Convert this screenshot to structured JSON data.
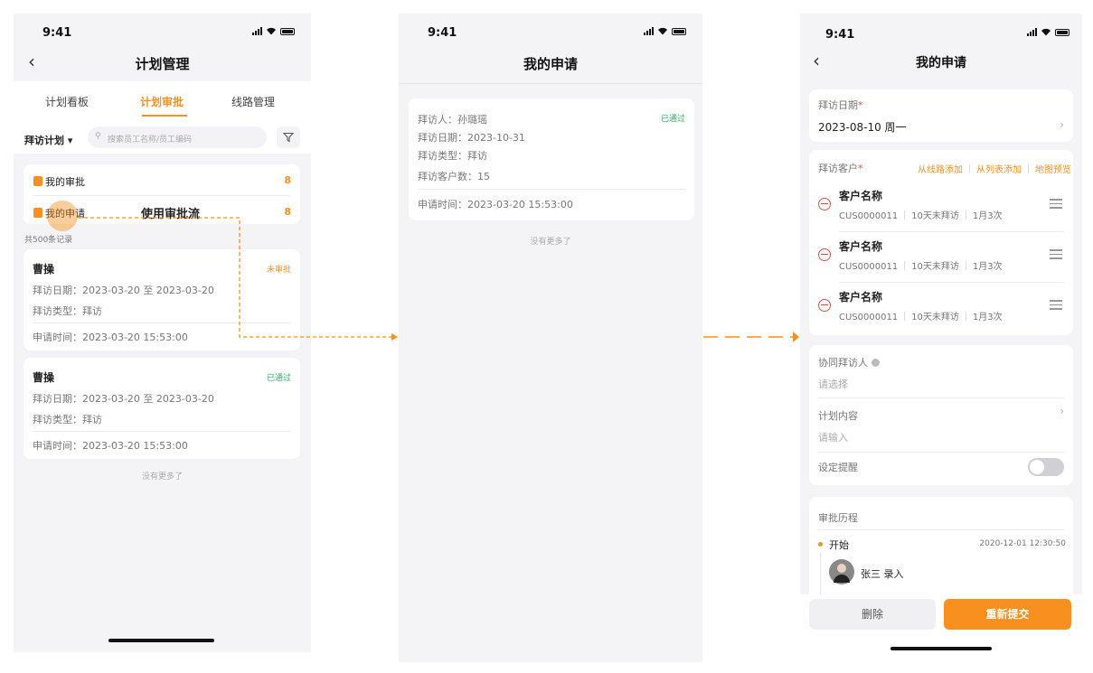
{
  "status": {
    "time": "9:41"
  },
  "screen1": {
    "title": "计划管理",
    "tabs": [
      "计划看板",
      "计划审批",
      "线路管理"
    ],
    "filter_dropdown": "拜访计划 ▾",
    "search_placeholder": "搜索员工名称/员工编码",
    "summary": [
      {
        "label": "我的审批",
        "count": "8"
      },
      {
        "label": "我的申请",
        "count": "8"
      }
    ],
    "annotation": "使用审批流",
    "record_count": "共500条记录",
    "records": [
      {
        "name": "曹操",
        "status": "未审批",
        "date": "拜访日期：2023-03-20 至 2023-03-20",
        "type": "拜访类型：拜访",
        "apply_time": "申请时间：2023-03-20 15:53:00"
      },
      {
        "name": "曹操",
        "status": "已通过",
        "date": "拜访日期：2023-03-20 至 2023-03-20",
        "type": "拜访类型：拜访",
        "apply_time": "申请时间：2023-03-20 15:53:00"
      }
    ],
    "no_more": "没有更多了"
  },
  "screen2": {
    "title": "我的申请",
    "card": {
      "visitor": "拜访人：孙璐瑶",
      "status": "已通过",
      "date": "拜访日期：2023-10-31",
      "type": "拜访类型：拜访",
      "customer_count": "拜访客户数：15",
      "apply_time": "申请时间：2023-03-20 15:53:00"
    },
    "no_more": "没有更多了"
  },
  "screen3": {
    "title": "我的申请",
    "visit_date_label": "拜访日期",
    "required_mark": "*",
    "visit_date_value": "2023-08-10 周一",
    "customer_label": "拜访客户",
    "customer_actions": [
      "从线路添加",
      "从列表添加",
      "地图预览"
    ],
    "customers": [
      {
        "name": "客户名称",
        "code": "CUS0000011",
        "last_visit": "10天未拜访",
        "frequency": "1月3次"
      },
      {
        "name": "客户名称",
        "code": "CUS0000011",
        "last_visit": "10天未拜访",
        "frequency": "1月3次"
      },
      {
        "name": "客户名称",
        "code": "CUS0000011",
        "last_visit": "10天未拜访",
        "frequency": "1月3次"
      }
    ],
    "co_visitor_label": "协同拜访人",
    "co_visitor_placeholder": "请选择",
    "plan_content_label": "计划内容",
    "plan_content_placeholder": "请输入",
    "reminder_label": "设定提醒",
    "reminder_on": false,
    "history_label": "审批历程",
    "history": [
      {
        "step": "开始",
        "time": "2020-12-01 12:30:50",
        "user": "张三",
        "action": "录入"
      }
    ],
    "delete_label": "删除",
    "resubmit_label": "重新提交"
  },
  "colors": {
    "accent": "#f7901e",
    "success": "#29b35b",
    "danger": "#e84a4a"
  }
}
